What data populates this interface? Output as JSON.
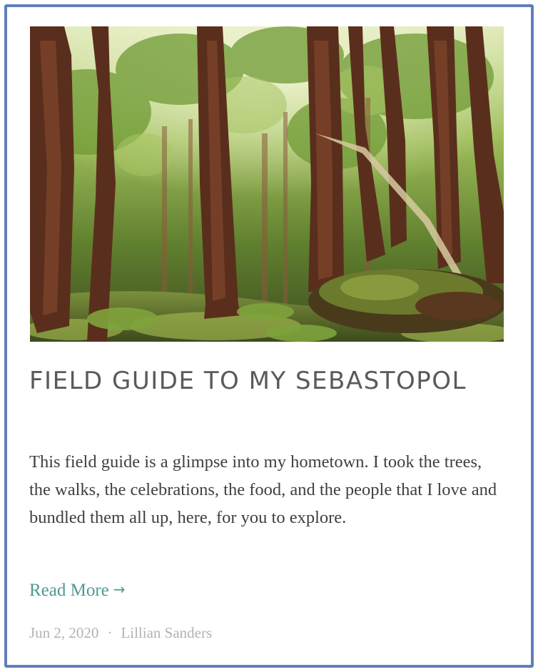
{
  "post": {
    "image_alt": "Redwood forest with tall trees and a moss-covered fallen log",
    "title": "FIELD GUIDE TO MY SEBASTOPOL",
    "excerpt": "This field guide is a glimpse into my hometown. I took the trees, the walks, the celebrations, the food, and the people that I love and bundled them all up, here, for you to explore.",
    "read_more_label": "Read More",
    "read_more_arrow": "→",
    "date": "Jun 2, 2020",
    "separator": "·",
    "author": "Lillian Sanders"
  },
  "colors": {
    "border": "#5f7fba",
    "title": "#585a5c",
    "body_text": "#3f3f3f",
    "link": "#4f9a92",
    "meta": "#b3b3b3"
  }
}
